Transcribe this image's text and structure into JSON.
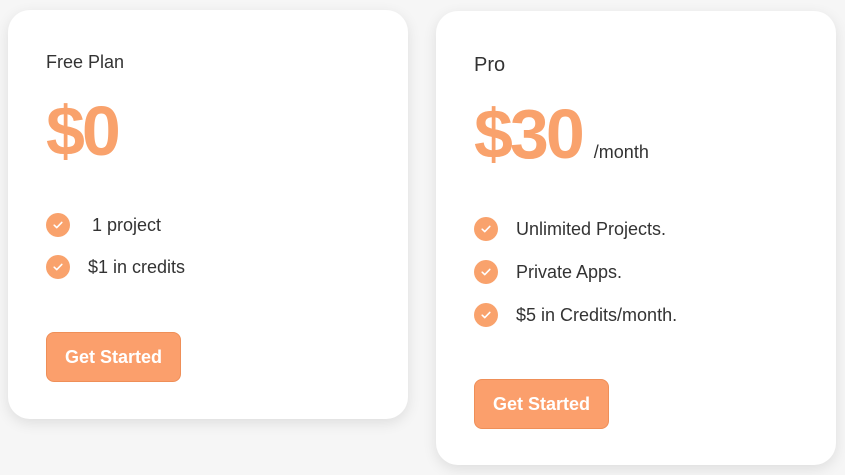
{
  "theme": {
    "accent": "#f9a26c",
    "text": "#333333",
    "card_background": "#ffffff",
    "page_background": "#f6f6f6"
  },
  "plans": [
    {
      "name": "Free Plan",
      "price": "$0",
      "period": "",
      "features": [
        "1 project",
        "$1 in credits"
      ],
      "cta_label": "Get Started",
      "feature_icon": "check-circle-icon"
    },
    {
      "name": "Pro",
      "price": "$30",
      "period": "/month",
      "features": [
        "Unlimited Projects.",
        "Private Apps.",
        "$5 in Credits/month."
      ],
      "cta_label": "Get Started",
      "feature_icon": "check-circle-icon"
    }
  ]
}
